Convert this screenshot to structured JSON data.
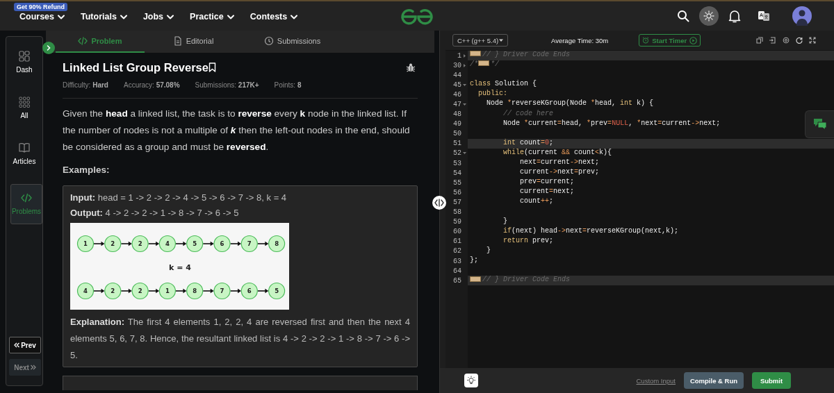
{
  "top_nav": {
    "promo_badge": "Get 90% Refund",
    "menu": [
      {
        "label": "Courses"
      },
      {
        "label": "Tutorials"
      },
      {
        "label": "Jobs"
      },
      {
        "label": "Practice"
      },
      {
        "label": "Contests"
      }
    ]
  },
  "sidebar": {
    "items": [
      {
        "label": "Dash",
        "selected": false
      },
      {
        "label": "All",
        "selected": false
      },
      {
        "label": "Articles",
        "selected": false
      },
      {
        "label": "Problems",
        "selected": true
      }
    ],
    "prev_button": {
      "label": "Prev",
      "disabled": false
    },
    "next_button": {
      "label": "Next",
      "disabled": true
    }
  },
  "problem_tabs": [
    {
      "label": "Problem",
      "selected": true
    },
    {
      "label": "Editorial",
      "selected": false
    },
    {
      "label": "Submissions",
      "selected": false
    }
  ],
  "problem": {
    "title": "Linked List Group Reverse",
    "meta": [
      "Difficulty: **Hard**",
      "Accuracy: **57.08%**",
      "Submissions: **217K+**",
      "Points: **8**"
    ],
    "description": "Given the **head** a linked list, the task is to **reverse** every **k** node in the linked list. If the number of nodes is not a multiple of *k* then the left-out nodes in the end, should be considered as a group and must be **reversed**.",
    "examples_heading": "Examples:",
    "example": {
      "input": "**Input:** head = 1 -> 2 -> 2 -> 4 -> 5 -> 6 -> 7 -> 8, k = 4",
      "output": "**Output:** 4 -> 2 -> 2 -> 1 -> 8 -> 7 -> 6 -> 5",
      "diagram": {
        "top_row": [
          "1",
          "2",
          "2",
          "4",
          "5",
          "6",
          "7",
          "8"
        ],
        "caption": "k = 4",
        "bottom_row": [
          "4",
          "2",
          "2",
          "1",
          "8",
          "7",
          "6",
          "5"
        ]
      },
      "explanation": "**Explanation:** The first 4 elements 1, 2, 2, 4 are reversed first and then the next 4 elements 5, 6, 7, 8. Hence, the resultant linked list is 4 -> 2 -> 2 -> 1 -> 8 -> 7 -> 6 -> 5."
    }
  },
  "editor": {
    "language": "C++ (g++ 5.4)",
    "average_time": "Average Time: 30m",
    "timer_button": "Start Timer",
    "lines": [
      {
        "number": "1",
        "foldable": true,
        "folded": true,
        "highlighted": true,
        "tokens": [
          {
            "kind": "fold-marker"
          },
          {
            "kind": "comment",
            "text": "// } Driver Code Ends"
          }
        ]
      },
      {
        "number": "30",
        "foldable": true,
        "folded": true,
        "highlighted": false,
        "tokens": [
          {
            "kind": "comment",
            "text": "/*"
          },
          {
            "kind": "fold-marker"
          },
          {
            "kind": "comment",
            "text": "*/"
          }
        ]
      },
      {
        "number": "44",
        "foldable": false,
        "folded": false,
        "highlighted": false
      },
      {
        "number": "45",
        "foldable": true,
        "folded": false,
        "highlighted": false,
        "tokens": [
          {
            "kind": "keyword",
            "text": "class"
          },
          {
            "kind": "plain",
            "text": " Solution {"
          }
        ]
      },
      {
        "number": "46",
        "foldable": false,
        "folded": false,
        "highlighted": false,
        "tokens": [
          {
            "kind": "keyword",
            "text": "  public:"
          }
        ]
      },
      {
        "number": "47",
        "foldable": true,
        "folded": false,
        "highlighted": false,
        "tokens": [
          {
            "kind": "plain",
            "text": "    Node "
          },
          {
            "kind": "operator",
            "text": "*"
          },
          {
            "kind": "plain",
            "text": "reverseKGroup(Node "
          },
          {
            "kind": "operator",
            "text": "*"
          },
          {
            "kind": "plain",
            "text": "head, "
          },
          {
            "kind": "keyword",
            "text": "int"
          },
          {
            "kind": "plain",
            "text": " k) {"
          }
        ]
      },
      {
        "number": "48",
        "foldable": false,
        "folded": false,
        "highlighted": false,
        "tokens": [
          {
            "kind": "comment",
            "text": "        // code here"
          }
        ]
      },
      {
        "number": "49",
        "foldable": false,
        "folded": false,
        "highlighted": false,
        "tokens": [
          {
            "kind": "plain",
            "text": "        Node "
          },
          {
            "kind": "operator",
            "text": "*"
          },
          {
            "kind": "plain",
            "text": "current"
          },
          {
            "kind": "operator",
            "text": "="
          },
          {
            "kind": "plain",
            "text": "head, "
          },
          {
            "kind": "operator",
            "text": "*"
          },
          {
            "kind": "plain",
            "text": "prev"
          },
          {
            "kind": "operator",
            "text": "="
          },
          {
            "kind": "number",
            "text": "NULL"
          },
          {
            "kind": "plain",
            "text": ", "
          },
          {
            "kind": "operator",
            "text": "*"
          },
          {
            "kind": "plain",
            "text": "next"
          },
          {
            "kind": "operator",
            "text": "="
          },
          {
            "kind": "plain",
            "text": "current"
          },
          {
            "kind": "operator",
            "text": "->"
          },
          {
            "kind": "plain",
            "text": "next;"
          }
        ]
      },
      {
        "number": "50",
        "foldable": false,
        "folded": false,
        "highlighted": false
      },
      {
        "number": "51",
        "foldable": false,
        "folded": false,
        "highlighted": true,
        "tokens": [
          {
            "kind": "keyword",
            "text": "        int"
          },
          {
            "kind": "plain",
            "text": " count"
          },
          {
            "kind": "operator",
            "text": "="
          },
          {
            "kind": "number",
            "text": "0"
          },
          {
            "kind": "plain",
            "text": ";"
          }
        ]
      },
      {
        "number": "52",
        "foldable": true,
        "folded": false,
        "highlighted": false,
        "tokens": [
          {
            "kind": "keyword",
            "text": "        while"
          },
          {
            "kind": "plain",
            "text": "(current "
          },
          {
            "kind": "operator",
            "text": "&&"
          },
          {
            "kind": "plain",
            "text": " count"
          },
          {
            "kind": "operator",
            "text": "<"
          },
          {
            "kind": "plain",
            "text": "k){"
          }
        ]
      },
      {
        "number": "53",
        "foldable": false,
        "folded": false,
        "highlighted": false,
        "tokens": [
          {
            "kind": "plain",
            "text": "            next"
          },
          {
            "kind": "operator",
            "text": "="
          },
          {
            "kind": "plain",
            "text": "current"
          },
          {
            "kind": "operator",
            "text": "->"
          },
          {
            "kind": "plain",
            "text": "next;"
          }
        ]
      },
      {
        "number": "54",
        "foldable": false,
        "folded": false,
        "highlighted": false,
        "tokens": [
          {
            "kind": "plain",
            "text": "            current"
          },
          {
            "kind": "operator",
            "text": "->"
          },
          {
            "kind": "plain",
            "text": "next"
          },
          {
            "kind": "operator",
            "text": "="
          },
          {
            "kind": "plain",
            "text": "prev;"
          }
        ]
      },
      {
        "number": "55",
        "foldable": false,
        "folded": false,
        "highlighted": false,
        "tokens": [
          {
            "kind": "plain",
            "text": "            prev"
          },
          {
            "kind": "operator",
            "text": "="
          },
          {
            "kind": "plain",
            "text": "current;"
          }
        ]
      },
      {
        "number": "56",
        "foldable": false,
        "folded": false,
        "highlighted": false,
        "tokens": [
          {
            "kind": "plain",
            "text": "            current"
          },
          {
            "kind": "operator",
            "text": "="
          },
          {
            "kind": "plain",
            "text": "next;"
          }
        ]
      },
      {
        "number": "57",
        "foldable": false,
        "folded": false,
        "highlighted": false,
        "tokens": [
          {
            "kind": "plain",
            "text": "            count"
          },
          {
            "kind": "operator",
            "text": "++"
          },
          {
            "kind": "plain",
            "text": ";"
          }
        ]
      },
      {
        "number": "58",
        "foldable": false,
        "folded": false,
        "highlighted": false
      },
      {
        "number": "59",
        "foldable": false,
        "folded": false,
        "highlighted": false,
        "tokens": [
          {
            "kind": "plain",
            "text": "        }"
          }
        ]
      },
      {
        "number": "60",
        "foldable": false,
        "folded": false,
        "highlighted": false,
        "tokens": [
          {
            "kind": "keyword",
            "text": "        if"
          },
          {
            "kind": "plain",
            "text": "(next) head"
          },
          {
            "kind": "operator",
            "text": "->"
          },
          {
            "kind": "plain",
            "text": "next"
          },
          {
            "kind": "operator",
            "text": "="
          },
          {
            "kind": "plain",
            "text": "reverseKGroup(next,k);"
          }
        ]
      },
      {
        "number": "61",
        "foldable": false,
        "folded": false,
        "highlighted": false,
        "tokens": [
          {
            "kind": "keyword",
            "text": "        return"
          },
          {
            "kind": "plain",
            "text": " prev;"
          }
        ]
      },
      {
        "number": "62",
        "foldable": false,
        "folded": false,
        "highlighted": false,
        "tokens": [
          {
            "kind": "plain",
            "text": "    }"
          }
        ]
      },
      {
        "number": "63",
        "foldable": false,
        "folded": false,
        "highlighted": false,
        "tokens": [
          {
            "kind": "plain",
            "text": "};"
          }
        ]
      },
      {
        "number": "64",
        "foldable": false,
        "folded": false,
        "highlighted": false
      },
      {
        "number": "65",
        "foldable": false,
        "folded": false,
        "highlighted": true,
        "tokens": [
          {
            "kind": "fold-marker"
          },
          {
            "kind": "comment",
            "text": "// } Driver Code Ends"
          }
        ]
      }
    ],
    "footer": {
      "custom_input": "Custom Input",
      "compile_button": "Compile & Run",
      "submit_button": "Submit"
    }
  }
}
